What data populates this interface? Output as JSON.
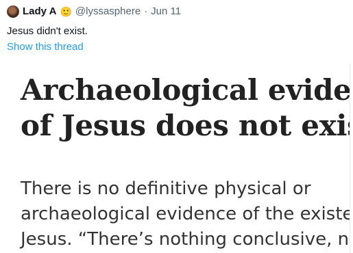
{
  "tweet": {
    "display_name": "Lady A",
    "name_emoji": "🙂",
    "handle": "@lyssasphere",
    "separator": "·",
    "date": "Jun 11",
    "text": "Jesus didn't exist.",
    "show_thread_label": "Show this thread"
  },
  "article_image": {
    "headline_lines": [
      "Archaeological eviden",
      "of Jesus does not exis"
    ],
    "body_lines": [
      "There is no definitive physical or",
      "archaeological evidence of the existe",
      "Jesus. “There’s nothing conclusive, nc"
    ]
  }
}
